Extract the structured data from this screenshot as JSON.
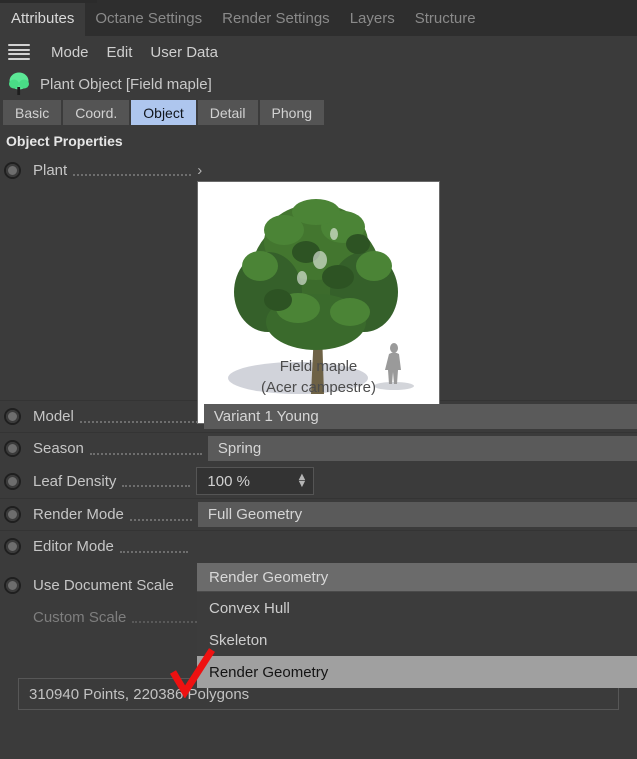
{
  "window": {
    "background": "#3b3b3b",
    "accent": "#aec6ee"
  },
  "tabbar": {
    "tabs": [
      {
        "label": "Attributes",
        "active": true
      },
      {
        "label": "Octane Settings",
        "active": false
      },
      {
        "label": "Render Settings",
        "active": false
      },
      {
        "label": "Layers",
        "active": false
      },
      {
        "label": "Structure",
        "active": false
      }
    ]
  },
  "menubar": {
    "icon": "hamburger-icon",
    "items": [
      {
        "label": "Mode"
      },
      {
        "label": "Edit"
      },
      {
        "label": "User Data"
      }
    ]
  },
  "object_header": {
    "icon": "tree-icon",
    "title": "Plant Object [Field maple]"
  },
  "subtabs": [
    {
      "label": "Basic",
      "selected": false
    },
    {
      "label": "Coord.",
      "selected": false
    },
    {
      "label": "Object",
      "selected": true
    },
    {
      "label": "Detail",
      "selected": false
    },
    {
      "label": "Phong",
      "selected": false
    }
  ],
  "section": {
    "title": "Object Properties"
  },
  "properties": {
    "plant": {
      "label": "Plant",
      "chevron": "›"
    },
    "model": {
      "label": "Model",
      "value": "Variant 1 Young"
    },
    "season": {
      "label": "Season",
      "value": "Spring"
    },
    "leaf_density": {
      "label": "Leaf Density",
      "value": "100 %"
    },
    "render_mode": {
      "label": "Render Mode",
      "value": "Full Geometry"
    },
    "editor_mode": {
      "label": "Editor Mode",
      "value": "Render Geometry"
    },
    "use_document_scale": {
      "label": "Use Document Scale"
    },
    "custom_scale": {
      "label": "Custom Scale",
      "disabled": true
    }
  },
  "preview": {
    "caption_common": "Field maple",
    "caption_latin": "(Acer campestre)"
  },
  "dropdown": {
    "open": true,
    "current": "Render Geometry",
    "options": [
      {
        "label": "Convex Hull",
        "highlighted": false
      },
      {
        "label": "Skeleton",
        "highlighted": false
      },
      {
        "label": "Render Geometry",
        "highlighted": true
      }
    ]
  },
  "statusbar": {
    "text": "310940 Points, 220386 Polygons"
  },
  "annotation": {
    "name": "red-check-mark",
    "color": "#ee1111"
  }
}
